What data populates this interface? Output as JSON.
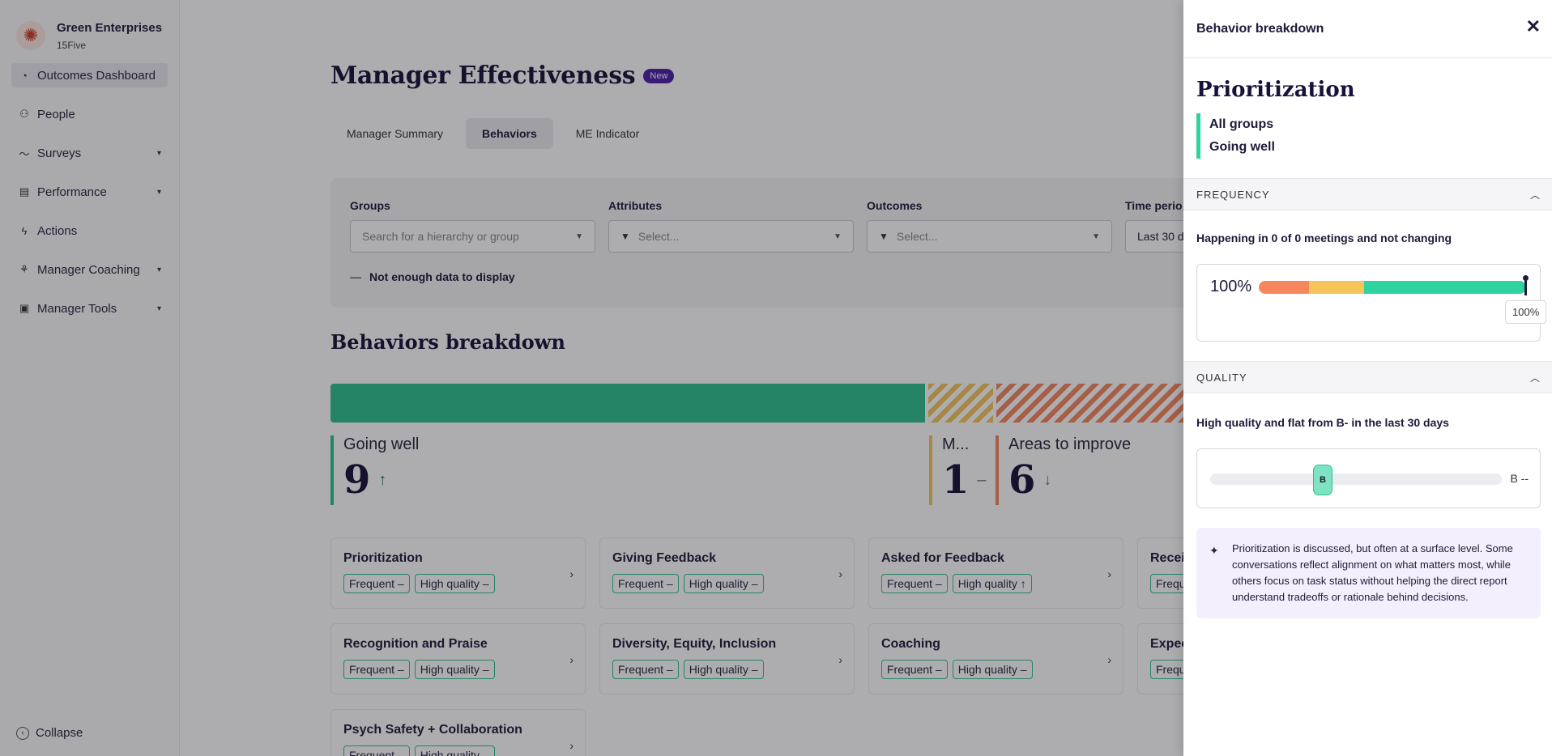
{
  "sidebar": {
    "org_name": "Green Enterprises",
    "org_sub": "15Five",
    "items": [
      {
        "label": "Outcomes Dashboard",
        "icon": "gauge-icon"
      },
      {
        "label": "People",
        "icon": "people-icon"
      },
      {
        "label": "Surveys",
        "icon": "pulse-icon"
      },
      {
        "label": "Performance",
        "icon": "clipboard-icon"
      },
      {
        "label": "Actions",
        "icon": "bolt-icon"
      },
      {
        "label": "Manager Coaching",
        "icon": "coaching-icon"
      },
      {
        "label": "Manager Tools",
        "icon": "toolbox-icon"
      }
    ],
    "collapse_label": "Collapse"
  },
  "page": {
    "title": "Manager Effectiveness",
    "badge": "New",
    "tabs": [
      "Manager Summary",
      "Behaviors",
      "ME Indicator"
    ]
  },
  "filters": {
    "groups_label": "Groups",
    "groups_placeholder": "Search for a hierarchy or group",
    "attributes_label": "Attributes",
    "attributes_placeholder": "Select...",
    "outcomes_label": "Outcomes",
    "outcomes_placeholder": "Select...",
    "time_label": "Time perio",
    "time_value": "Last 30 d",
    "no_data": "Not enough data to display"
  },
  "breakdown": {
    "title": "Behaviors breakdown",
    "going_well_label": "Going well",
    "going_well_value": "9",
    "going_well_trend": "↑",
    "middle_label": "M...",
    "middle_value": "1",
    "middle_trend": "–",
    "improve_label": "Areas to improve",
    "improve_value": "6",
    "improve_trend": "↓"
  },
  "cards": [
    {
      "title": "Prioritization",
      "tag1": "Frequent –",
      "tag2": "High quality –"
    },
    {
      "title": "Giving Feedback",
      "tag1": "Frequent –",
      "tag2": "High quality –"
    },
    {
      "title": "Asked for Feedback",
      "tag1": "Frequent –",
      "tag2": "High quality ↑"
    },
    {
      "title": "Recei",
      "tag1": "Frequ",
      "tag2": ""
    },
    {
      "title": "Recognition and Praise",
      "tag1": "Frequent –",
      "tag2": "High quality –"
    },
    {
      "title": "Diversity, Equity, Inclusion",
      "tag1": "Frequent –",
      "tag2": "High quality –"
    },
    {
      "title": "Coaching",
      "tag1": "Frequent –",
      "tag2": "High quality –"
    },
    {
      "title": "Expec",
      "tag1": "Frequ",
      "tag2": ""
    },
    {
      "title": "Psych Safety + Collaboration",
      "tag1": "Frequent –",
      "tag2": "High quality –"
    }
  ],
  "panel": {
    "header": "Behavior breakdown",
    "close": "✕",
    "title": "Prioritization",
    "group": "All groups",
    "status": "Going well",
    "frequency_label": "FREQUENCY",
    "frequency_text": "Happening in 0 of 0 meetings and not changing",
    "frequency_pct": "100%",
    "frequency_tooltip": "100%",
    "frequency_value": 100,
    "quality_label": "QUALITY",
    "quality_text": "High quality and flat from B- in the last 30 days",
    "quality_grade": "B",
    "quality_right": "B --",
    "insight": "Prioritization is discussed, but often at a surface level. Some conversations reflect alignment on what matters most, while others focus on task status without helping the direct report understand tradeoffs or rationale behind decisions."
  }
}
